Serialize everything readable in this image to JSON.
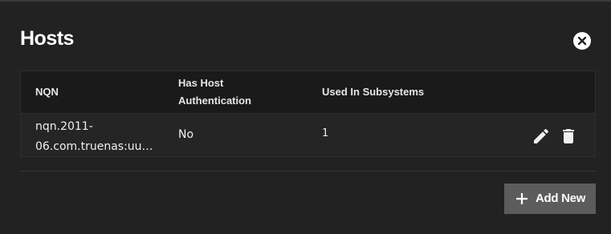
{
  "dialog": {
    "title": "Hosts",
    "close_icon": "close-circle-icon"
  },
  "table": {
    "columns": [
      "NQN",
      "Has Host Authentication",
      "Used In Subsystems"
    ],
    "column_lines": {
      "nqn": "NQN",
      "auth_line1": "Has Host",
      "auth_line2": "Authentication",
      "used": "Used In Subsystems"
    },
    "rows": [
      {
        "nqn_line1": "nqn.2011-",
        "nqn_line2": "06.com.truenas:uu…",
        "has_host_authentication": "No",
        "used_in_subsystems": "1",
        "actions": [
          "edit-icon",
          "delete-icon"
        ]
      }
    ]
  },
  "footer": {
    "add_label": "Add New",
    "add_icon": "plus-icon"
  },
  "colors": {
    "background": "#222222",
    "header_bg": "#1a1a1a",
    "row_bg": "#252525",
    "button_bg": "#5c5c5c",
    "text": "#ffffff"
  }
}
